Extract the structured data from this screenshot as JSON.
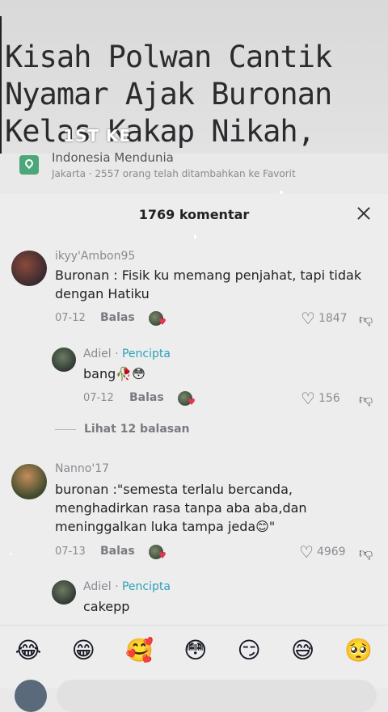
{
  "video": {
    "title": "Kisah Polwan Cantik\nNyamar Ajak Buronan\nKelas Kakap Nikah, Saat",
    "sticker": "1ST KE"
  },
  "location": {
    "name": "Indonesia Mendunia",
    "subtitle": "Jakarta · 2557 orang telah ditambahkan ke Favorit"
  },
  "sheet": {
    "comment_count": "1769 komentar"
  },
  "comments": [
    {
      "user": "ikyy'Ambon95",
      "text": "Buronan : Fisik ku memang penjahat, tapi tidak dengan Hatiku",
      "date": "07-12",
      "reply_label": "Balas",
      "likes": "1847",
      "replies": [
        {
          "user": "Adiel",
          "creator_label": "Pencipta",
          "text": "bang🥀😳",
          "date": "07-12",
          "reply_label": "Balas",
          "likes": "156"
        }
      ],
      "view_replies": "Lihat 12 balasan"
    },
    {
      "user": "Nanno'17",
      "text": "buronan :\"semesta terlalu bercanda, menghadirkan rasa tanpa aba aba,dan meninggalkan luka tampa jeda😊\"",
      "date": "07-13",
      "reply_label": "Balas",
      "likes": "4969",
      "replies": [
        {
          "user": "Adiel",
          "creator_label": "Pencipta",
          "text": "cakepp"
        }
      ]
    }
  ],
  "emoji_bar": [
    "😂",
    "😁",
    "🥰",
    "😳",
    "😏",
    "😅",
    "🥺"
  ]
}
